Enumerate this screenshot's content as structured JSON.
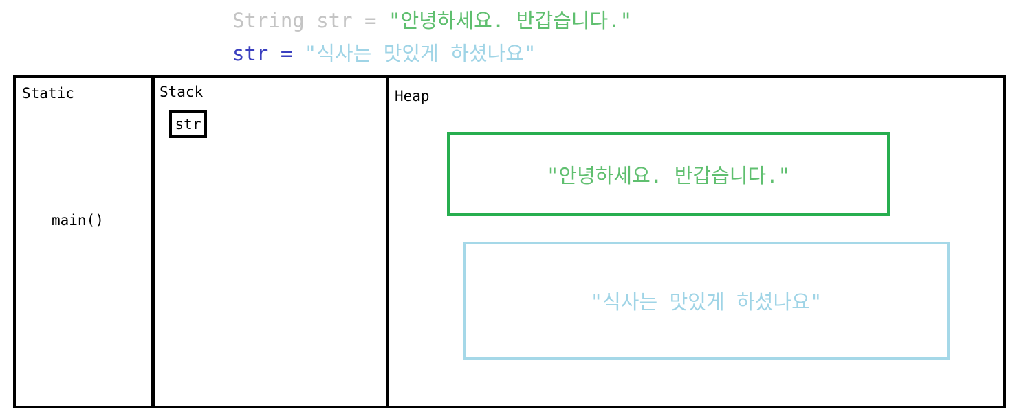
{
  "code": {
    "line1": {
      "keyword": "String str = ",
      "literal": "\"안녕하세요. 반갑습니다.\""
    },
    "line2": {
      "assign": "str = ",
      "literal": "\"식사는 맛있게 하셨나요\""
    }
  },
  "regions": {
    "static": {
      "label": "Static",
      "method": "main()"
    },
    "stack": {
      "label": "Stack",
      "variable": "str"
    },
    "heap": {
      "label": "Heap",
      "objects": [
        {
          "text": "\"안녕하세요. 반갑습니다.\"",
          "color": "#27ae4f"
        },
        {
          "text": "\"식사는 맛있게 하셨나요\"",
          "color": "#a5d8e8"
        }
      ]
    }
  },
  "colors": {
    "code_keyword": "#c4c4c4",
    "code_assign": "#3a3fbf",
    "literal_1": "#5fbf6f",
    "literal_2": "#9fd4e6"
  }
}
